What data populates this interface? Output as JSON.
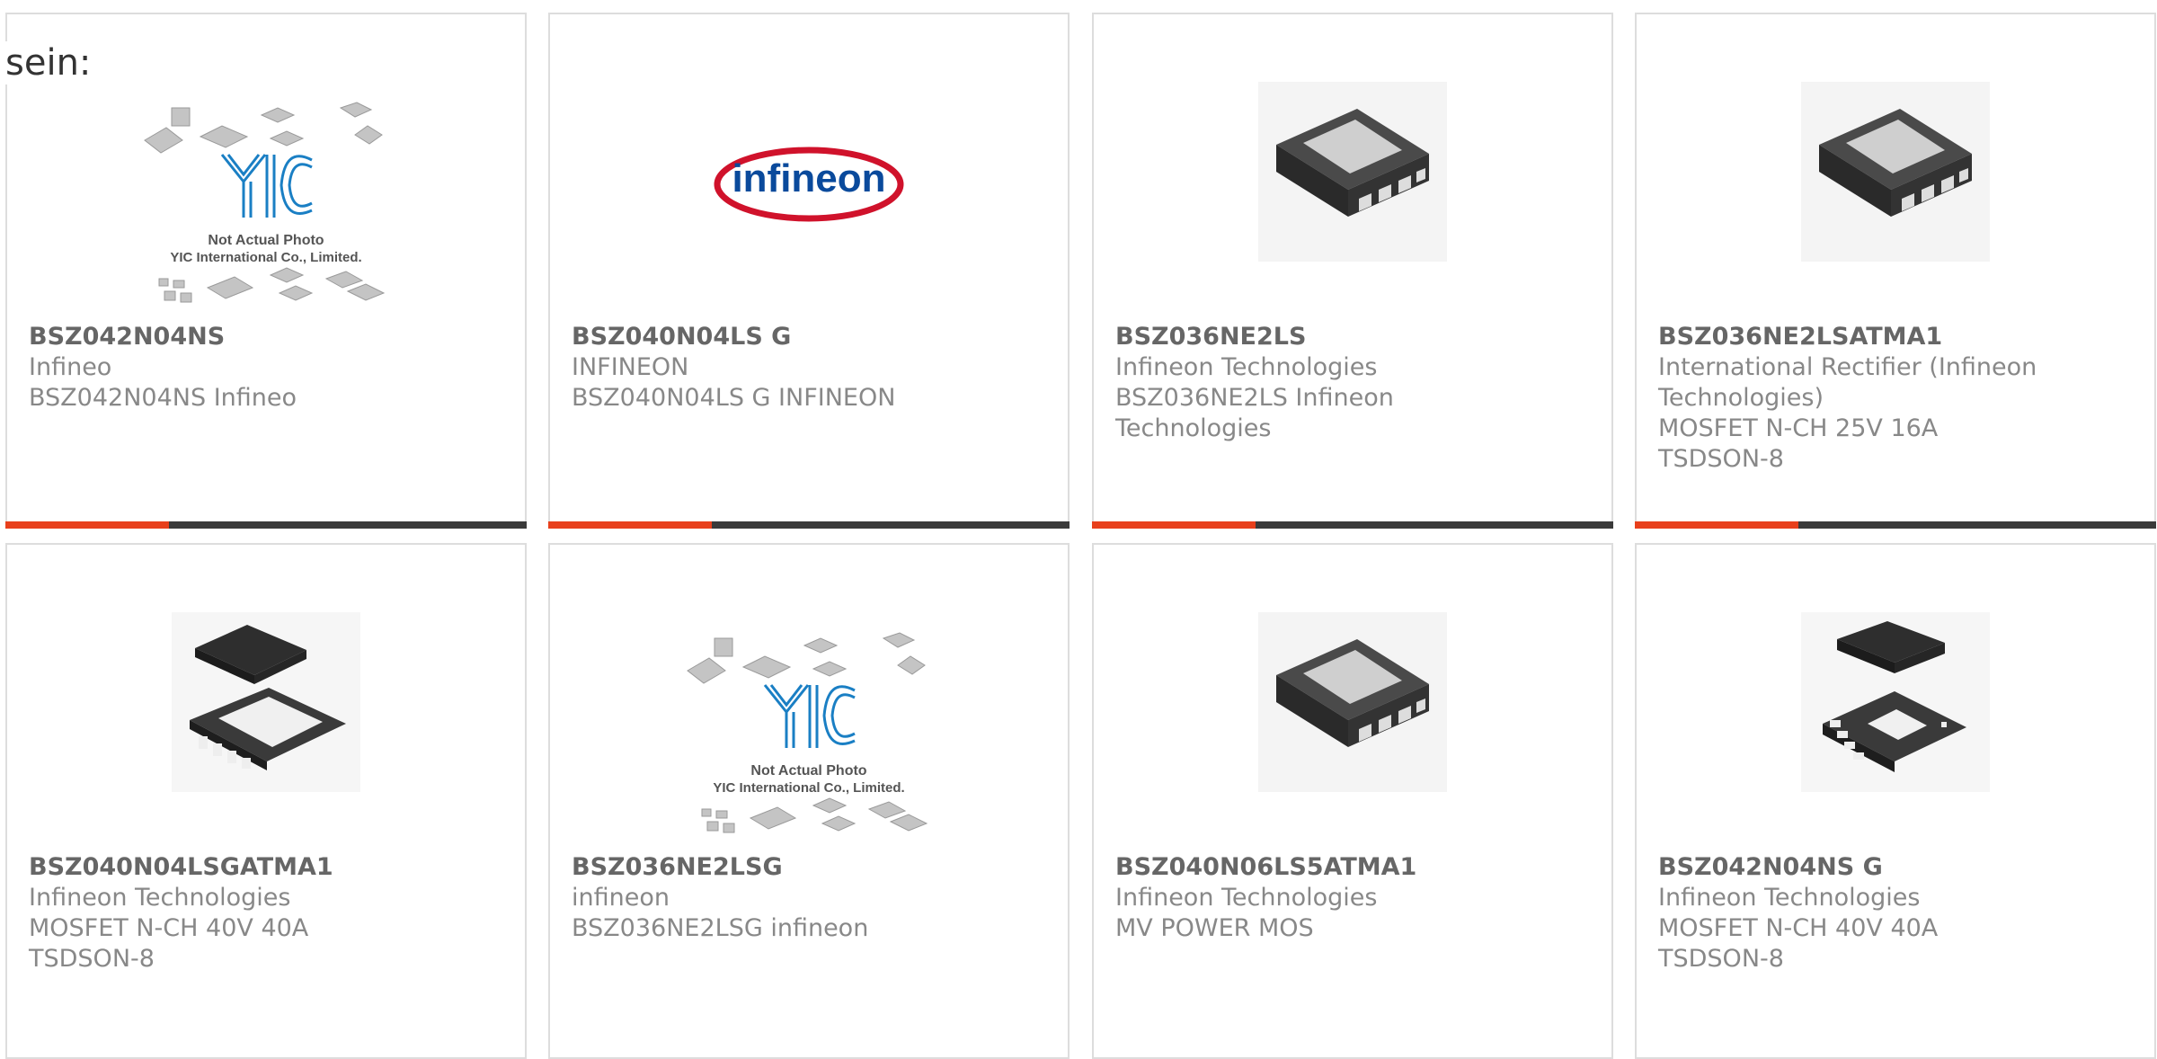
{
  "intro_text": "sein:",
  "colors": {
    "accent": "#e8401c",
    "bar": "#3a3a3a",
    "infineon_red": "#d0122b",
    "infineon_blue": "#0a4a9c"
  },
  "placeholder": {
    "logo": "YIC",
    "caption_line1": "Not Actual Photo",
    "caption_line2": "YIC International Co., Limited."
  },
  "brand_logo_text": "infineon",
  "products": [
    {
      "part": "BSZ042N04NS",
      "manufacturer": "Infineo",
      "description": "BSZ042N04NS Infineo",
      "image": "placeholder-photo"
    },
    {
      "part": "BSZ040N04LS G",
      "manufacturer": "INFINEON",
      "description": "BSZ040N04LS G INFINEON",
      "image": "infineon-logo"
    },
    {
      "part": "BSZ036NE2LS",
      "manufacturer": "Infineon Technologies",
      "description": "BSZ036NE2LS Infineon Technologies",
      "image": "chip-tsdson8"
    },
    {
      "part": "BSZ036NE2LSATMA1",
      "manufacturer": "International Rectifier (Infineon Technologies)",
      "description": "MOSFET N-CH 25V 16A TSDSON-8",
      "image": "chip-tsdson8"
    },
    {
      "part": "BSZ040N04LSGATMA1",
      "manufacturer": "Infineon Technologies",
      "description": "MOSFET N-CH 40V 40A TSDSON-8",
      "image": "chip-top-bottom"
    },
    {
      "part": "BSZ036NE2LSG",
      "manufacturer": "infineon",
      "description": "BSZ036NE2LSG infineon",
      "image": "placeholder-photo"
    },
    {
      "part": "BSZ040N06LS5ATMA1",
      "manufacturer": "Infineon Technologies",
      "description": "MV POWER MOS",
      "image": "chip-tsdson8"
    },
    {
      "part": "BSZ042N04NS G",
      "manufacturer": "Infineon Technologies",
      "description": "MOSFET N-CH 40V 40A TSDSON-8",
      "image": "chip-pair"
    }
  ]
}
